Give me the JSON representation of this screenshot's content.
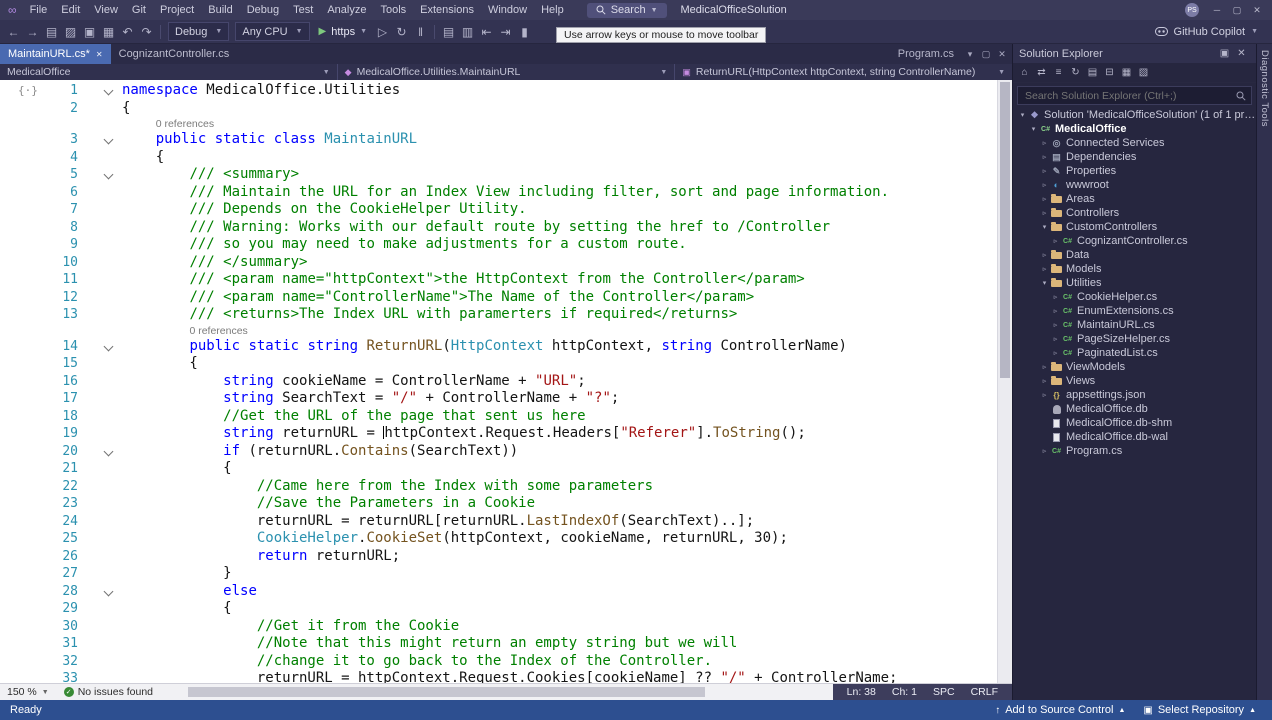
{
  "title_bar": {
    "menus": [
      "File",
      "Edit",
      "View",
      "Git",
      "Project",
      "Build",
      "Debug",
      "Test",
      "Analyze",
      "Tools",
      "Extensions",
      "Window",
      "Help"
    ],
    "search_label": "Search",
    "solution_name": "MedicalOfficeSolution",
    "avatar_initials": "PS",
    "window_icons": [
      {
        "name": "minimize-icon",
        "glyph": "─"
      },
      {
        "name": "maximize-icon",
        "glyph": "▢"
      },
      {
        "name": "close-icon",
        "glyph": "✕"
      }
    ]
  },
  "toolbar": {
    "icons_left": [
      {
        "name": "navigate-back-icon",
        "glyph": "←"
      },
      {
        "name": "navigate-forward-icon",
        "glyph": "→"
      },
      {
        "name": "new-file-icon",
        "glyph": "▤"
      },
      {
        "name": "open-file-icon",
        "glyph": "▨"
      },
      {
        "name": "save-icon",
        "glyph": "▣"
      },
      {
        "name": "save-all-icon",
        "glyph": "▦"
      },
      {
        "name": "undo-icon",
        "glyph": "↶"
      },
      {
        "name": "redo-icon",
        "glyph": "↷"
      }
    ],
    "debug_config": "Debug",
    "platform": "Any CPU",
    "run_target": "https",
    "icons_run": [
      {
        "name": "start-without-debugging-icon",
        "glyph": "▷"
      },
      {
        "name": "hot-reload-icon",
        "glyph": "↻"
      },
      {
        "name": "break-all-icon",
        "glyph": "‖"
      }
    ],
    "icons_edit": [
      {
        "name": "comment-icon",
        "glyph": "▤"
      },
      {
        "name": "uncomment-icon",
        "glyph": "▥"
      },
      {
        "name": "decrease-indent-icon",
        "glyph": "⇤"
      },
      {
        "name": "increase-indent-icon",
        "glyph": "⇥"
      },
      {
        "name": "bookmark-icon",
        "glyph": "▮"
      }
    ],
    "copilot_label": "GitHub Copilot",
    "tooltip": "Use arrow keys or mouse to move toolbar"
  },
  "tabs": {
    "left": [
      {
        "label": "MaintainURL.cs*",
        "active": true
      },
      {
        "label": "CognizantController.cs",
        "active": false
      }
    ],
    "right_label": "Program.cs",
    "right_icons": [
      {
        "name": "active-files-dropdown-icon",
        "glyph": "▾"
      },
      {
        "name": "float-tab-icon",
        "glyph": "▢"
      },
      {
        "name": "close-document-icon",
        "glyph": "✕"
      }
    ]
  },
  "breadcrumb": {
    "project": "MedicalOffice",
    "type_path": "MedicalOffice.Utilities.MaintainURL",
    "member": "ReturnURL(HttpContext httpContext, string ControllerName)"
  },
  "editor": {
    "margin_glyph": "{·}",
    "lines": [
      {
        "n": 1,
        "fold": true,
        "t": [
          [
            "k",
            "namespace"
          ],
          [
            "p",
            " MedicalOffice.Utilities"
          ]
        ]
      },
      {
        "n": 2,
        "t": [
          [
            "p",
            "{"
          ]
        ]
      },
      {
        "ref": "0 references",
        "ind": 4
      },
      {
        "n": 3,
        "fold": true,
        "t": [
          [
            "p",
            "    "
          ],
          [
            "k",
            "public static class "
          ],
          [
            "y",
            "MaintainURL"
          ]
        ]
      },
      {
        "n": 4,
        "t": [
          [
            "p",
            "    {"
          ]
        ]
      },
      {
        "n": 5,
        "fold": true,
        "t": [
          [
            "p",
            "        "
          ],
          [
            "c",
            "/// <summary>"
          ]
        ]
      },
      {
        "n": 6,
        "t": [
          [
            "p",
            "        "
          ],
          [
            "c",
            "/// Maintain the URL for an Index View including filter, sort and page information."
          ]
        ]
      },
      {
        "n": 7,
        "t": [
          [
            "p",
            "        "
          ],
          [
            "c",
            "/// Depends on the CookieHelper Utility."
          ]
        ]
      },
      {
        "n": 8,
        "t": [
          [
            "p",
            "        "
          ],
          [
            "c",
            "/// Warning: Works with our default route by setting the href to /Controller"
          ]
        ]
      },
      {
        "n": 9,
        "t": [
          [
            "p",
            "        "
          ],
          [
            "c",
            "/// so you may need to make adjustments for a custom route."
          ]
        ]
      },
      {
        "n": 10,
        "t": [
          [
            "p",
            "        "
          ],
          [
            "c",
            "/// </summary>"
          ]
        ]
      },
      {
        "n": 11,
        "t": [
          [
            "p",
            "        "
          ],
          [
            "c",
            "/// <param name=\"httpContext\">the HttpContext from the Controller</param>"
          ]
        ]
      },
      {
        "n": 12,
        "t": [
          [
            "p",
            "        "
          ],
          [
            "c",
            "/// <param name=\"ControllerName\">The Name of the Controller</param>"
          ]
        ]
      },
      {
        "n": 13,
        "t": [
          [
            "p",
            "        "
          ],
          [
            "c",
            "/// <returns>The Index URL with paramerters if required</returns>"
          ]
        ]
      },
      {
        "ref": "0 references",
        "ind": 8
      },
      {
        "n": 14,
        "fold": true,
        "t": [
          [
            "p",
            "        "
          ],
          [
            "k",
            "public static string "
          ],
          [
            "m",
            "ReturnURL"
          ],
          [
            "p",
            "("
          ],
          [
            "y",
            "HttpContext"
          ],
          [
            "p",
            " httpContext, "
          ],
          [
            "k",
            "string"
          ],
          [
            "p",
            " ControllerName)"
          ]
        ]
      },
      {
        "n": 15,
        "t": [
          [
            "p",
            "        {"
          ]
        ]
      },
      {
        "n": 16,
        "t": [
          [
            "p",
            "            "
          ],
          [
            "k",
            "string"
          ],
          [
            "p",
            " cookieName = ControllerName + "
          ],
          [
            "s",
            "\"URL\""
          ],
          [
            "p",
            ";"
          ]
        ]
      },
      {
        "n": 17,
        "t": [
          [
            "p",
            "            "
          ],
          [
            "k",
            "string"
          ],
          [
            "p",
            " SearchText = "
          ],
          [
            "s",
            "\"/\""
          ],
          [
            "p",
            " + ControllerName + "
          ],
          [
            "s",
            "\"?\""
          ],
          [
            "p",
            ";"
          ]
        ]
      },
      {
        "n": 18,
        "t": [
          [
            "p",
            "            "
          ],
          [
            "c",
            "//Get the URL of the page that sent us here"
          ]
        ]
      },
      {
        "n": 19,
        "t": [
          [
            "p",
            "            "
          ],
          [
            "k",
            "string"
          ],
          [
            "p",
            " returnURL = "
          ],
          [
            "caret",
            ""
          ],
          [
            "p",
            "httpContext.Request.Headers["
          ],
          [
            "s",
            "\"Referer\""
          ],
          [
            "p",
            "]."
          ],
          [
            "m",
            "ToString"
          ],
          [
            "p",
            "();"
          ]
        ]
      },
      {
        "n": 20,
        "fold": true,
        "t": [
          [
            "p",
            "            "
          ],
          [
            "k",
            "if"
          ],
          [
            "p",
            " (returnURL."
          ],
          [
            "m",
            "Contains"
          ],
          [
            "p",
            "(SearchText))"
          ]
        ]
      },
      {
        "n": 21,
        "t": [
          [
            "p",
            "            {"
          ]
        ]
      },
      {
        "n": 22,
        "t": [
          [
            "p",
            "                "
          ],
          [
            "c",
            "//Came here from the Index with some parameters"
          ]
        ]
      },
      {
        "n": 23,
        "t": [
          [
            "p",
            "                "
          ],
          [
            "c",
            "//Save the Parameters in a Cookie"
          ]
        ]
      },
      {
        "n": 24,
        "t": [
          [
            "p",
            "                returnURL = returnURL[returnURL."
          ],
          [
            "m",
            "LastIndexOf"
          ],
          [
            "p",
            "(SearchText)..];"
          ]
        ]
      },
      {
        "n": 25,
        "t": [
          [
            "p",
            "                "
          ],
          [
            "y",
            "CookieHelper"
          ],
          [
            "p",
            "."
          ],
          [
            "m",
            "CookieSet"
          ],
          [
            "p",
            "(httpContext, cookieName, returnURL, 30);"
          ]
        ]
      },
      {
        "n": 26,
        "t": [
          [
            "p",
            "                "
          ],
          [
            "k",
            "return"
          ],
          [
            "p",
            " returnURL;"
          ]
        ]
      },
      {
        "n": 27,
        "t": [
          [
            "p",
            "            }"
          ]
        ]
      },
      {
        "n": 28,
        "fold": true,
        "t": [
          [
            "p",
            "            "
          ],
          [
            "k",
            "else"
          ]
        ]
      },
      {
        "n": 29,
        "t": [
          [
            "p",
            "            {"
          ]
        ]
      },
      {
        "n": 30,
        "t": [
          [
            "p",
            "                "
          ],
          [
            "c",
            "//Get it from the Cookie"
          ]
        ]
      },
      {
        "n": 31,
        "t": [
          [
            "p",
            "                "
          ],
          [
            "c",
            "//Note that this might return an empty string but we will"
          ]
        ]
      },
      {
        "n": 32,
        "t": [
          [
            "p",
            "                "
          ],
          [
            "c",
            "//change it to go back to the Index of the Controller."
          ]
        ]
      },
      {
        "n": 33,
        "t": [
          [
            "p",
            "                returnURL = httpContext.Request.Cookies[cookieName] ?? "
          ],
          [
            "s",
            "\"/\""
          ],
          [
            "p",
            " + ControllerName;"
          ]
        ]
      }
    ]
  },
  "editor_status": {
    "zoom": "150 %",
    "no_issues": "No issues found",
    "ln": "Ln: 38",
    "ch": "Ch: 1",
    "enc": "SPC",
    "eol": "CRLF"
  },
  "solution_explorer": {
    "title": "Solution Explorer",
    "title_icons": [
      {
        "name": "dock-panel-icon",
        "glyph": "▣"
      },
      {
        "name": "close-panel-icon",
        "glyph": "✕"
      }
    ],
    "toolbar_icons": [
      {
        "name": "home-icon",
        "glyph": "⌂"
      },
      {
        "name": "switch-views-icon",
        "glyph": "⇄"
      },
      {
        "name": "filter-icon",
        "glyph": "≡"
      },
      {
        "name": "refresh-icon",
        "glyph": "↻"
      },
      {
        "name": "nest-files-icon",
        "glyph": "▤"
      },
      {
        "name": "collapse-all-icon",
        "glyph": "⊟"
      },
      {
        "name": "show-all-files-icon",
        "glyph": "▦"
      },
      {
        "name": "properties-icon",
        "glyph": "▧"
      }
    ],
    "search_placeholder": "Search Solution Explorer (Ctrl+;)",
    "tree": [
      {
        "indent": 0,
        "exp": "open",
        "icon": "sln",
        "label": "Solution 'MedicalOfficeSolution' (1 of 1 project)"
      },
      {
        "indent": 1,
        "exp": "open",
        "icon": "proj",
        "label": "MedicalOffice",
        "bold": true
      },
      {
        "indent": 2,
        "exp": "closed",
        "icon": "svc",
        "label": "Connected Services"
      },
      {
        "indent": 2,
        "exp": "closed",
        "icon": "dep",
        "label": "Dependencies"
      },
      {
        "indent": 2,
        "exp": "closed",
        "icon": "prop",
        "label": "Properties"
      },
      {
        "indent": 2,
        "exp": "closed",
        "icon": "www",
        "label": "wwwroot"
      },
      {
        "indent": 2,
        "exp": "closed",
        "icon": "folder",
        "label": "Areas"
      },
      {
        "indent": 2,
        "exp": "closed",
        "icon": "folder",
        "label": "Controllers"
      },
      {
        "indent": 2,
        "exp": "open",
        "icon": "folder",
        "label": "CustomControllers"
      },
      {
        "indent": 3,
        "exp": "closed",
        "icon": "cs",
        "label": "CognizantController.cs"
      },
      {
        "indent": 2,
        "exp": "closed",
        "icon": "folder",
        "label": "Data"
      },
      {
        "indent": 2,
        "exp": "closed",
        "icon": "folder",
        "label": "Models"
      },
      {
        "indent": 2,
        "exp": "open",
        "icon": "folder",
        "label": "Utilities"
      },
      {
        "indent": 3,
        "exp": "closed",
        "icon": "cs",
        "label": "CookieHelper.cs"
      },
      {
        "indent": 3,
        "exp": "closed",
        "icon": "cs",
        "label": "EnumExtensions.cs"
      },
      {
        "indent": 3,
        "exp": "closed",
        "icon": "cs",
        "label": "MaintainURL.cs"
      },
      {
        "indent": 3,
        "exp": "closed",
        "icon": "cs",
        "label": "PageSizeHelper.cs"
      },
      {
        "indent": 3,
        "exp": "closed",
        "icon": "cs",
        "label": "PaginatedList.cs"
      },
      {
        "indent": 2,
        "exp": "closed",
        "icon": "folder",
        "label": "ViewModels"
      },
      {
        "indent": 2,
        "exp": "closed",
        "icon": "folder",
        "label": "Views"
      },
      {
        "indent": 2,
        "exp": "closed",
        "icon": "json",
        "label": "appsettings.json"
      },
      {
        "indent": 2,
        "icon": "db",
        "label": "MedicalOffice.db"
      },
      {
        "indent": 2,
        "icon": "file",
        "label": "MedicalOffice.db-shm"
      },
      {
        "indent": 2,
        "icon": "file",
        "label": "MedicalOffice.db-wal"
      },
      {
        "indent": 2,
        "exp": "closed",
        "icon": "cs",
        "label": "Program.cs"
      }
    ]
  },
  "right_strip": {
    "label": "Diagnostic Tools"
  },
  "status_bar": {
    "ready": "Ready",
    "add_source_control": "Add to Source Control",
    "select_repository": "Select Repository"
  },
  "colors": {
    "active_tab": "#4a6ab1",
    "status_bar": "#2d4f90",
    "keyword": "#0000ff",
    "type": "#2b91af",
    "string": "#a31515",
    "comment": "#008000"
  }
}
